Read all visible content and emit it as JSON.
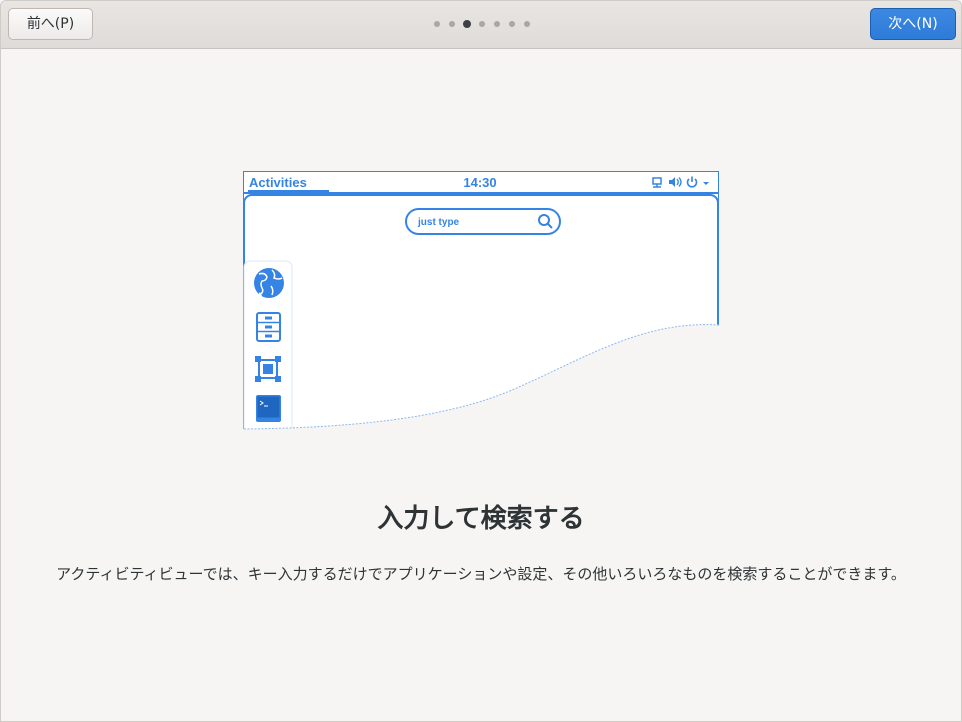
{
  "header": {
    "prev_label": "前へ(P)",
    "next_label": "次へ(N)",
    "page_count": 7,
    "current_page": 3
  },
  "illustration": {
    "activities_label": "Activities",
    "clock": "14:30",
    "search_placeholder": "just type",
    "dash_icons": [
      "web-browser-icon",
      "file-cabinet-icon",
      "vector-graphics-icon",
      "terminal-icon"
    ],
    "status_icons": [
      "network-icon",
      "volume-icon",
      "power-icon",
      "dropdown-arrow-icon"
    ],
    "accent_color": "#3584e4"
  },
  "main": {
    "title": "入力して検索する",
    "description": "アクティビティビューでは、キー入力するだけでアプリケーションや設定、その他いろいろなものを検索することができます。"
  }
}
